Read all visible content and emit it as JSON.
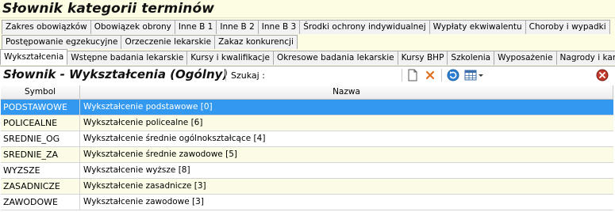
{
  "window": {
    "title": "Słownik kategorii terminów"
  },
  "tabs": {
    "row1": [
      "Zakres obowiązków",
      "Obowiązek obrony",
      "Inne B 1",
      "Inne B 2",
      "Inne B 3",
      "Środki ochrony indywidualnej",
      "Wypłaty ekwiwalentu",
      "Choroby i wypadki"
    ],
    "row2": [
      "Postępowanie egzekucyjne",
      "Orzeczenie lekarskie",
      "Zakaz konkurencji"
    ],
    "row3": [
      "Wykształcenia",
      "Wstępne badania lekarskie",
      "Kursy i kwalifikacje",
      "Okresowe badania lekarskie",
      "Kursy BHP",
      "Szkolenia",
      "Wyposażenie",
      "Nagrody i kary"
    ],
    "active": "Wykształcenia"
  },
  "toolbar": {
    "subtitle": "Słownik - Wykształcenia (Ogólny)",
    "search_label": "Szukaj   :",
    "search_value": "",
    "icons": [
      "new-document-icon",
      "delete-icon",
      "refresh-icon",
      "table-view-icon",
      "dropdown-arrow-icon",
      "close-icon"
    ],
    "accent": "#3399f0",
    "close_color": "#c0392b"
  },
  "grid": {
    "columns": [
      "Symbol",
      "Nazwa"
    ],
    "rows": [
      {
        "symbol": "PODSTAWOWE",
        "nazwa": "Wykształcenie podstawowe [0]",
        "selected": true
      },
      {
        "symbol": "POLICEALNE",
        "nazwa": "Wykształcenie policealne [6]"
      },
      {
        "symbol": "SREDNIE_OG",
        "nazwa": "Wykształcenie średnie ogólnokształcące [4]"
      },
      {
        "symbol": "SREDNIE_ZA",
        "nazwa": "Wykształcenie średnie zawodowe [5]"
      },
      {
        "symbol": "WYZSZE",
        "nazwa": "Wykształcenie wyższe [8]"
      },
      {
        "symbol": "ZASADNICZE",
        "nazwa": "Wykształcenie zasadnicze [3]"
      },
      {
        "symbol": "ZAWODOWE",
        "nazwa": "Wykształcenie zawodowe [3]"
      }
    ]
  }
}
